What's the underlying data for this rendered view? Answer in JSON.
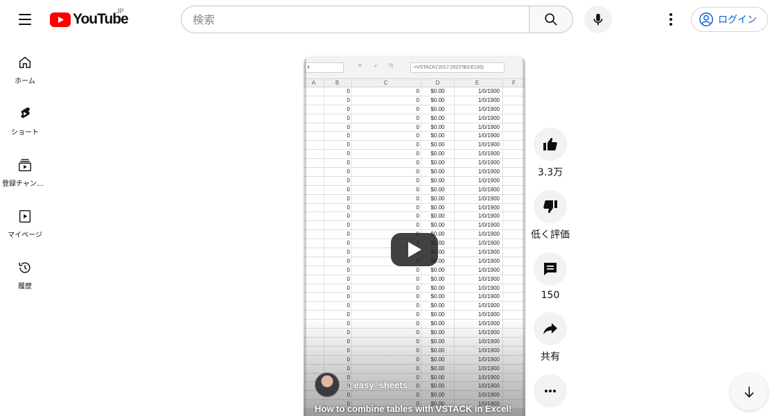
{
  "header": {
    "logo_text": "YouTube",
    "region": "JP",
    "search_placeholder": "検索",
    "login_label": "ログイン"
  },
  "sidebar": {
    "items": [
      {
        "label": "ホーム",
        "icon": "home-icon"
      },
      {
        "label": "ショート",
        "icon": "shorts-icon"
      },
      {
        "label": "登録チャンネル",
        "icon": "subscriptions-icon"
      },
      {
        "label": "マイページ",
        "icon": "you-icon"
      },
      {
        "label": "履歴",
        "icon": "history-icon"
      }
    ]
  },
  "video": {
    "channel": "@easy_sheets",
    "title": "How to combine tables with VSTACK in Excel!",
    "sheet": {
      "namebox": "4",
      "formula": "=VSTACK('2017:2022'!B3:E100)",
      "columns": [
        "A",
        "B",
        "C",
        "D",
        "E",
        "F"
      ],
      "row_values": [
        "0",
        "0",
        "$0.00",
        "1/0/1900"
      ],
      "row_count": 36
    }
  },
  "actions": {
    "like_count": "3.3万",
    "dislike_label": "低く評価",
    "comment_count": "150",
    "share_label": "共有"
  },
  "colors": {
    "youtube_red": "#ff0000",
    "link_blue": "#065fd4"
  }
}
